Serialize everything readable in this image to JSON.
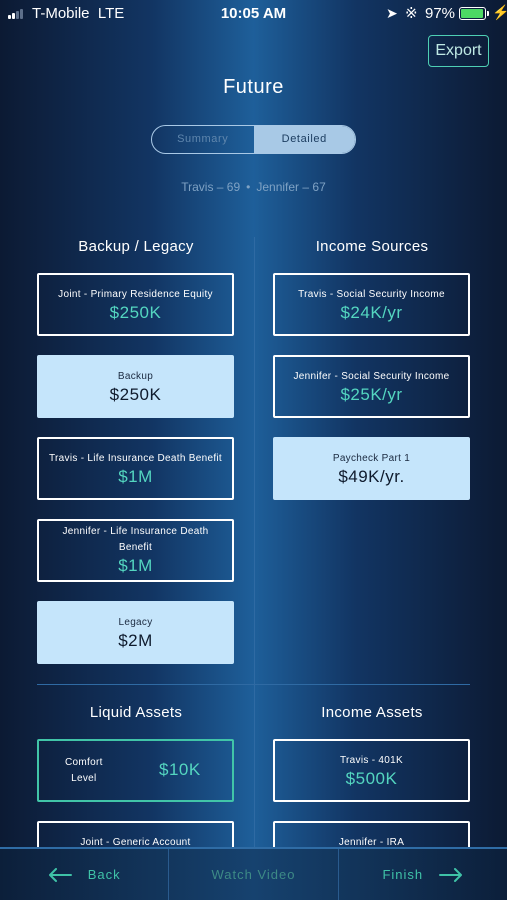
{
  "status_bar": {
    "carrier": "T-Mobile",
    "network": "LTE",
    "time": "10:05 AM",
    "battery": "97%",
    "battery_level": 0.97,
    "battery_color": "#4cd964"
  },
  "header": {
    "export_label": "Export",
    "title": "Future"
  },
  "view_toggle": {
    "options": [
      "Summary",
      "Detailed"
    ],
    "selected": "Detailed"
  },
  "ages": {
    "first": "Travis – 69",
    "separator": "•",
    "second": "Jennifer – 67"
  },
  "backup_legacy": {
    "heading": "Backup / Legacy",
    "cards": [
      {
        "label": "Joint - Primary Residence Equity",
        "value": "$250K"
      },
      {
        "label": "Backup",
        "value": "$250K"
      },
      {
        "label": "Travis - Life Insurance Death Benefit",
        "value": "$1M"
      },
      {
        "label": "Jennifer - Life Insurance Death Benefit",
        "value": "$1M"
      },
      {
        "label": "Legacy",
        "value": "$2M"
      }
    ]
  },
  "income_sources": {
    "heading": "Income Sources",
    "cards": [
      {
        "label": "Travis - Social Security Income",
        "value": "$24K/yr"
      },
      {
        "label": "Jennifer - Social Security Income",
        "value": "$25K/yr"
      },
      {
        "label": "Paycheck Part 1",
        "value": "$49K/yr."
      }
    ]
  },
  "liquid_assets": {
    "heading": "Liquid Assets",
    "comfort": {
      "label_line1": "Comfort",
      "label_line2": "Level",
      "value": "$10K"
    },
    "cards": [
      {
        "label": "Joint - Generic Account"
      }
    ]
  },
  "income_assets": {
    "heading": "Income Assets",
    "cards": [
      {
        "label": "Travis - 401K",
        "value": "$500K"
      },
      {
        "label": "Jennifer - IRA"
      }
    ]
  },
  "bottom_bar": {
    "back": "Back",
    "watch_video": "Watch Video",
    "finish": "Finish"
  },
  "colors": {
    "accent_teal": "#54d6c0",
    "card_light": "#c5e5fb",
    "toggle_selected": "#a8c9e6"
  }
}
